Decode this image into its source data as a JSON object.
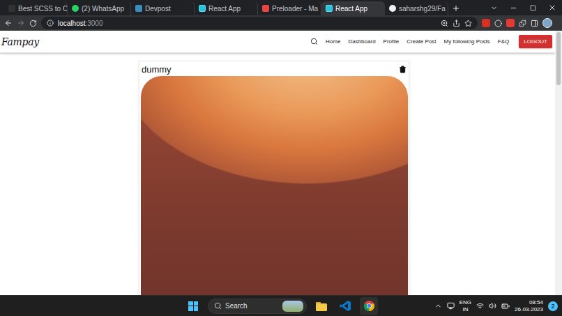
{
  "browser": {
    "tabs": [
      {
        "label": "Best SCSS to C",
        "selected": false,
        "kind": "scss"
      },
      {
        "label": "(2) WhatsApp",
        "selected": false,
        "kind": "whatsapp"
      },
      {
        "label": "Devpost",
        "selected": false,
        "kind": "devpost"
      },
      {
        "label": "React App",
        "selected": false,
        "kind": "react"
      },
      {
        "label": "Preloader - Ma",
        "selected": false,
        "kind": "preloader"
      },
      {
        "label": "React App",
        "selected": true,
        "kind": "react"
      },
      {
        "label": "saharshg29/Fa",
        "selected": false,
        "kind": "github"
      }
    ],
    "address": {
      "host": "localhost",
      "port": ":3000"
    }
  },
  "navbar": {
    "logo": "Fampay",
    "links": [
      "Home",
      "Dashboard",
      "Profile",
      "Create Post",
      "My following Posts",
      "F&Q"
    ],
    "logout": "LOGOUT"
  },
  "post": {
    "title": "dummy"
  },
  "taskbar": {
    "search": "Search",
    "language": [
      "ENG",
      "IN"
    ],
    "time": "08:54",
    "date": "26-03-2023",
    "notifications": "2"
  }
}
